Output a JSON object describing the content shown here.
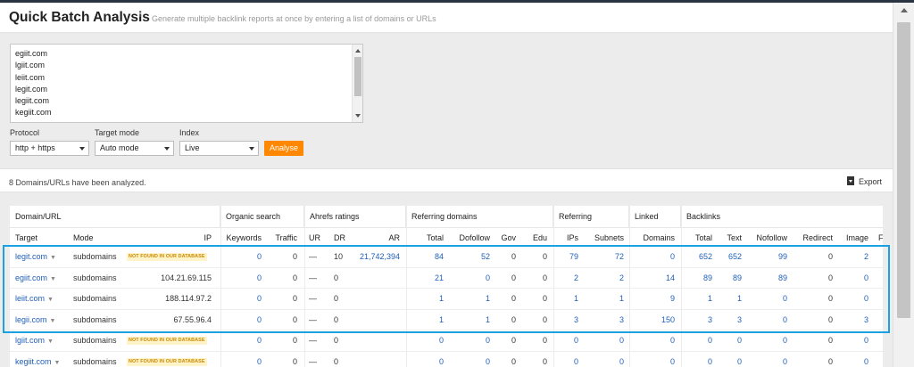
{
  "header": {
    "title": "Quick Batch Analysis",
    "info": "i",
    "subtitle": "Generate multiple backlink reports at once by entering a list of domains or URLs"
  },
  "input": {
    "lines": [
      "egiit.com",
      "lgiit.com",
      "leiit.com",
      "legit.com",
      "legiit.com",
      "kegiit.com",
      "..."
    ]
  },
  "controls": {
    "protocol_label": "Protocol",
    "protocol_value": "http + https",
    "target_mode_label": "Target mode",
    "target_mode_value": "Auto mode",
    "index_label": "Index",
    "index_value": "Live",
    "analyse_label": "Analyse"
  },
  "status": {
    "text": "8 Domains/URLs have been analyzed.",
    "export_label": "Export"
  },
  "table": {
    "groups": [
      "Domain/URL",
      "Organic search",
      "Ahrefs ratings",
      "Referring domains",
      "Referring",
      "Linked",
      "Backlinks"
    ],
    "headers": [
      "Target",
      "Mode",
      "IP",
      "Keywords",
      "Traffic",
      "UR",
      "DR",
      "AR",
      "Total",
      "Dofollow",
      "Gov",
      "Edu",
      "IPs",
      "Subnets",
      "Domains",
      "Total",
      "Text",
      "Nofollow",
      "Redirect",
      "Image",
      "F"
    ],
    "not_found_label": "NOT FOUND IN OUR DATABASE",
    "rows": [
      {
        "target": "legit.com",
        "mode": "subdomains",
        "ip": "",
        "notfound": true,
        "keywords": "0",
        "traffic": "0",
        "ur": "—",
        "dr": "10",
        "ar": "21,742,394",
        "rd_total": "84",
        "dofollow": "52",
        "gov": "0",
        "edu": "0",
        "ips": "79",
        "subnets": "72",
        "linked": "0",
        "bl_total": "652",
        "text": "652",
        "nofollow": "99",
        "redirect": "0",
        "image": "2"
      },
      {
        "target": "egiit.com",
        "mode": "subdomains",
        "ip": "104.21.69.115",
        "notfound": false,
        "keywords": "0",
        "traffic": "0",
        "ur": "—",
        "dr": "0",
        "ar": "",
        "rd_total": "21",
        "dofollow": "0",
        "gov": "0",
        "edu": "0",
        "ips": "2",
        "subnets": "2",
        "linked": "14",
        "bl_total": "89",
        "text": "89",
        "nofollow": "89",
        "redirect": "0",
        "image": "0"
      },
      {
        "target": "leiit.com",
        "mode": "subdomains",
        "ip": "188.114.97.2",
        "notfound": false,
        "keywords": "0",
        "traffic": "0",
        "ur": "—",
        "dr": "0",
        "ar": "",
        "rd_total": "1",
        "dofollow": "1",
        "gov": "0",
        "edu": "0",
        "ips": "1",
        "subnets": "1",
        "linked": "9",
        "bl_total": "1",
        "text": "1",
        "nofollow": "0",
        "redirect": "0",
        "image": "0"
      },
      {
        "target": "legii.com",
        "mode": "subdomains",
        "ip": "67.55.96.4",
        "notfound": false,
        "keywords": "0",
        "traffic": "0",
        "ur": "—",
        "dr": "0",
        "ar": "",
        "rd_total": "1",
        "dofollow": "1",
        "gov": "0",
        "edu": "0",
        "ips": "3",
        "subnets": "3",
        "linked": "150",
        "bl_total": "3",
        "text": "3",
        "nofollow": "0",
        "redirect": "0",
        "image": "3"
      },
      {
        "target": "lgiit.com",
        "mode": "subdomains",
        "ip": "",
        "notfound": true,
        "keywords": "0",
        "traffic": "0",
        "ur": "—",
        "dr": "0",
        "ar": "",
        "rd_total": "0",
        "dofollow": "0",
        "gov": "0",
        "edu": "0",
        "ips": "0",
        "subnets": "0",
        "linked": "0",
        "bl_total": "0",
        "text": "0",
        "nofollow": "0",
        "redirect": "0",
        "image": "0"
      },
      {
        "target": "kegiit.com",
        "mode": "subdomains",
        "ip": "",
        "notfound": true,
        "keywords": "0",
        "traffic": "0",
        "ur": "—",
        "dr": "0",
        "ar": "",
        "rd_total": "0",
        "dofollow": "0",
        "gov": "0",
        "edu": "0",
        "ips": "0",
        "subnets": "0",
        "linked": "0",
        "bl_total": "0",
        "text": "0",
        "nofollow": "0",
        "redirect": "0",
        "image": "0"
      }
    ]
  }
}
